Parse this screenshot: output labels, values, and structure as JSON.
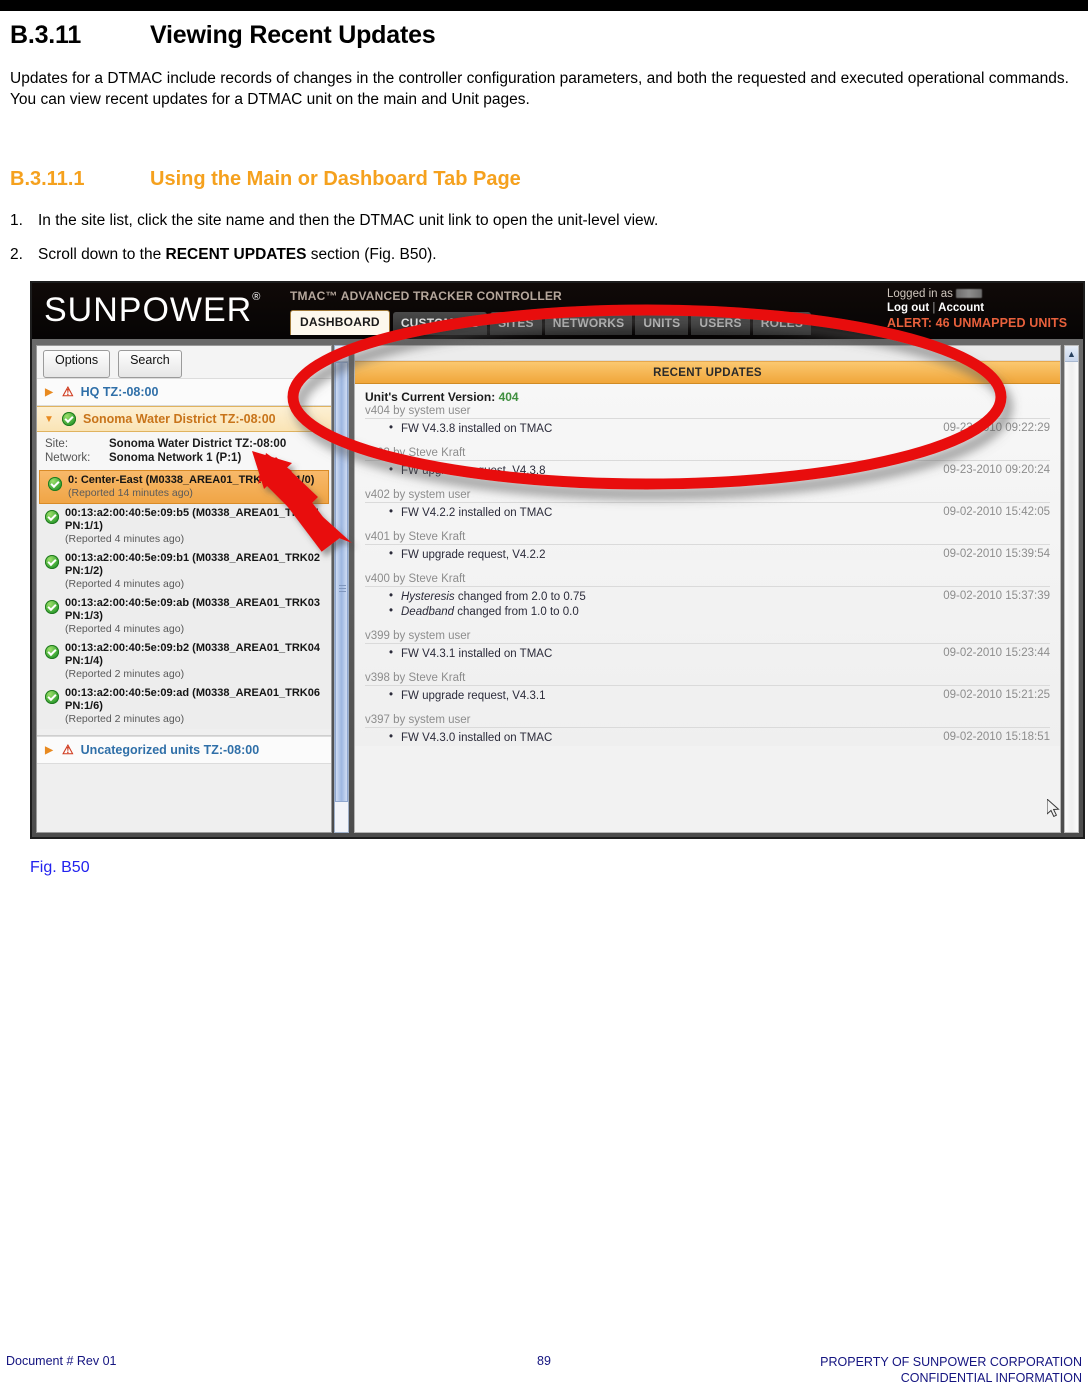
{
  "doc": {
    "section_number": "B.3.11",
    "section_title": "Viewing Recent Updates",
    "intro_paragraph": "Updates for a DTMAC include records of changes in the controller configuration parameters, and both the requested and executed operational commands. You can view recent updates for a DTMAC unit on the main and Unit pages.",
    "subsection_number": "B.3.11.1",
    "subsection_title": "Using the Main or Dashboard Tab Page",
    "steps": [
      {
        "marker": "1.",
        "pre": "In the site list, click the site name and then the DTMAC unit link to open the unit-level view.",
        "bold": "",
        "post": ""
      },
      {
        "marker": "2.",
        "pre": "Scroll down to the ",
        "bold": "RECENT UPDATES",
        "post": " section (Fig. B50)."
      }
    ],
    "figure_caption": "Fig. B50",
    "accent_color": "#F5A11E",
    "caption_color": "#2222EE"
  },
  "footer": {
    "left": "Document #  Rev 01",
    "page_number": "89",
    "right_line1": "PROPERTY OF SUNPOWER CORPORATION",
    "right_line2": "CONFIDENTIAL INFORMATION"
  },
  "app": {
    "logo_text": "SUNPOWER",
    "tagline": "TMAC™ ADVANCED TRACKER CONTROLLER",
    "tabs": [
      {
        "label": "DASHBOARD",
        "active": true
      },
      {
        "label": "CUSTOMERS",
        "active": false
      },
      {
        "label": "SITES",
        "active": false
      },
      {
        "label": "NETWORKS",
        "active": false
      },
      {
        "label": "UNITS",
        "active": false
      },
      {
        "label": "USERS",
        "active": false
      },
      {
        "label": "ROLES",
        "active": false
      }
    ],
    "session": {
      "logged_in_as_label": "Logged in as",
      "logged_in_as_value": "",
      "log_out": "Log out",
      "separator": "|",
      "account": "Account",
      "alert": "ALERT: 46 UNMAPPED UNITS",
      "alert_color": "#E8603C"
    },
    "left_panel": {
      "options_button": "Options",
      "search_button": "Search",
      "tree": [
        {
          "label": "HQ TZ:-08:00",
          "icon": "warning-icon",
          "expanded": false
        },
        {
          "label": "Sonoma Water District TZ:-08:00",
          "icon": "status-ok-icon",
          "expanded": true
        }
      ],
      "site_label": "Site:",
      "site_value": "Sonoma Water District TZ:-08:00",
      "network_label": "Network:",
      "network_value": "Sonoma Network 1 (P:1)",
      "units": [
        {
          "name": "0: Center-East (M0338_AREA01_TRK05 PN:1/0)",
          "reported": "(Reported 14 minutes ago)",
          "highlight": true
        },
        {
          "name": "00:13:a2:00:40:5e:09:b5 (M0338_AREA01_TRK01 PN:1/1)",
          "reported": "(Reported 4 minutes ago)",
          "highlight": false
        },
        {
          "name": "00:13:a2:00:40:5e:09:b1 (M0338_AREA01_TRK02 PN:1/2)",
          "reported": "(Reported 4 minutes ago)",
          "highlight": false
        },
        {
          "name": "00:13:a2:00:40:5e:09:ab (M0338_AREA01_TRK03 PN:1/3)",
          "reported": "(Reported 4 minutes ago)",
          "highlight": false
        },
        {
          "name": "00:13:a2:00:40:5e:09:b2 (M0338_AREA01_TRK04 PN:1/4)",
          "reported": "(Reported 2 minutes ago)",
          "highlight": false
        },
        {
          "name": "00:13:a2:00:40:5e:09:ad (M0338_AREA01_TRK06 PN:1/6)",
          "reported": "(Reported 2 minutes ago)",
          "highlight": false
        }
      ],
      "uncategorized_label": "Uncategorized units TZ:-08:00"
    },
    "recent_updates": {
      "header": "RECENT UPDATES",
      "current_version_label": "Unit's Current Version:",
      "current_version_value": "404",
      "groups": [
        {
          "who": "v404 by system user",
          "items": [
            {
              "text": "FW V4.3.8 installed on TMAC",
              "italic_prefix": ""
            }
          ],
          "when": "09-23-2010 09:22:29"
        },
        {
          "who": "v403 by Steve Kraft",
          "items": [
            {
              "text": "FW upgrade request, V4.3.8",
              "italic_prefix": ""
            }
          ],
          "when": "09-23-2010 09:20:24"
        },
        {
          "who": "v402 by system user",
          "items": [
            {
              "text": "FW V4.2.2 installed on TMAC",
              "italic_prefix": ""
            }
          ],
          "when": "09-02-2010 15:42:05"
        },
        {
          "who": "v401 by Steve Kraft",
          "items": [
            {
              "text": "FW upgrade request, V4.2.2",
              "italic_prefix": ""
            }
          ],
          "when": "09-02-2010 15:39:54"
        },
        {
          "who": "v400 by Steve Kraft",
          "items": [
            {
              "text": " changed from 2.0 to 0.75",
              "italic_prefix": "Hysteresis"
            },
            {
              "text": " changed from 1.0 to 0.0",
              "italic_prefix": "Deadband"
            }
          ],
          "when": "09-02-2010 15:37:39"
        },
        {
          "who": "v399 by system user",
          "items": [
            {
              "text": "FW V4.3.1 installed on TMAC",
              "italic_prefix": ""
            }
          ],
          "when": "09-02-2010 15:23:44"
        },
        {
          "who": "v398 by Steve Kraft",
          "items": [
            {
              "text": "FW upgrade request, V4.3.1",
              "italic_prefix": ""
            }
          ],
          "when": "09-02-2010 15:21:25"
        },
        {
          "who": "v397 by system user",
          "items": [
            {
              "text": "FW V4.3.0 installed on TMAC",
              "italic_prefix": ""
            }
          ],
          "when": "09-02-2010 15:18:51"
        }
      ]
    },
    "annotations": {
      "ellipse_color": "#E81010",
      "arrow_color": "#E81010"
    }
  }
}
